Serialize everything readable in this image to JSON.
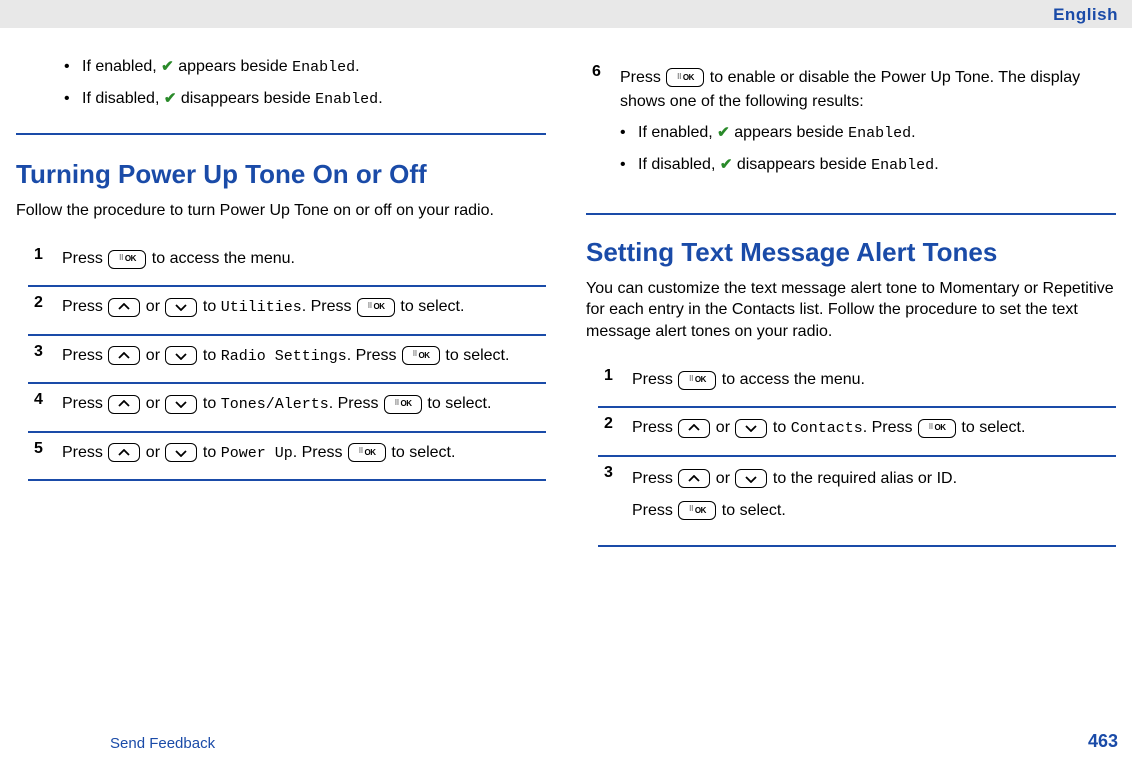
{
  "header": {
    "language": "English"
  },
  "footer": {
    "feedback": "Send Feedback",
    "page": "463"
  },
  "icons": {
    "ok": "OK"
  },
  "left": {
    "prev_bullets": [
      {
        "pre": "If enabled, ",
        "post": " appears beside ",
        "code": "Enabled",
        "tail": "."
      },
      {
        "pre": "If disabled, ",
        "post": " disappears beside ",
        "code": "Enabled",
        "tail": "."
      }
    ],
    "h": "Turning Power Up Tone On or Off",
    "intro": "Follow the procedure to turn Power Up Tone on or off on your radio.",
    "steps": {
      "s1": {
        "a": "Press ",
        "b": " to access the menu."
      },
      "s2": {
        "a": "Press ",
        "b": " or ",
        "c": " to ",
        "code": "Utilities",
        "d": ". Press ",
        "e": " to select."
      },
      "s3": {
        "a": "Press ",
        "b": " or ",
        "c": " to ",
        "code": "Radio Settings",
        "d": ". Press ",
        "e": " to select."
      },
      "s4": {
        "a": "Press ",
        "b": " or ",
        "c": " to ",
        "code": "Tones/Alerts",
        "d": ". Press ",
        "e": " to select."
      },
      "s5": {
        "a": "Press ",
        "b": " or ",
        "c": " to ",
        "code": "Power Up",
        "d": ". Press ",
        "e": " to select."
      }
    }
  },
  "right": {
    "s6": {
      "a": "Press ",
      "b": " to enable or disable the Power Up Tone. The display shows one of the following results:"
    },
    "s6_bullets": [
      {
        "pre": "If enabled, ",
        "post": " appears beside ",
        "code": "Enabled",
        "tail": "."
      },
      {
        "pre": "If disabled, ",
        "post": " disappears beside ",
        "code": "Enabled",
        "tail": "."
      }
    ],
    "h": "Setting Text Message Alert Tones",
    "intro": "You can customize the text message alert tone to Momentary or Repetitive for each entry in the Contacts list. Follow the procedure to set the text message alert tones on your radio.",
    "steps": {
      "s1": {
        "a": "Press ",
        "b": " to access the menu."
      },
      "s2": {
        "a": "Press ",
        "b": " or ",
        "c": " to ",
        "code": "Contacts",
        "d": ". Press ",
        "e": " to select."
      },
      "s3": {
        "a": "Press ",
        "b": " or ",
        "c": " to the required alias or ID.",
        "d": "Press ",
        "e": " to select."
      }
    }
  }
}
